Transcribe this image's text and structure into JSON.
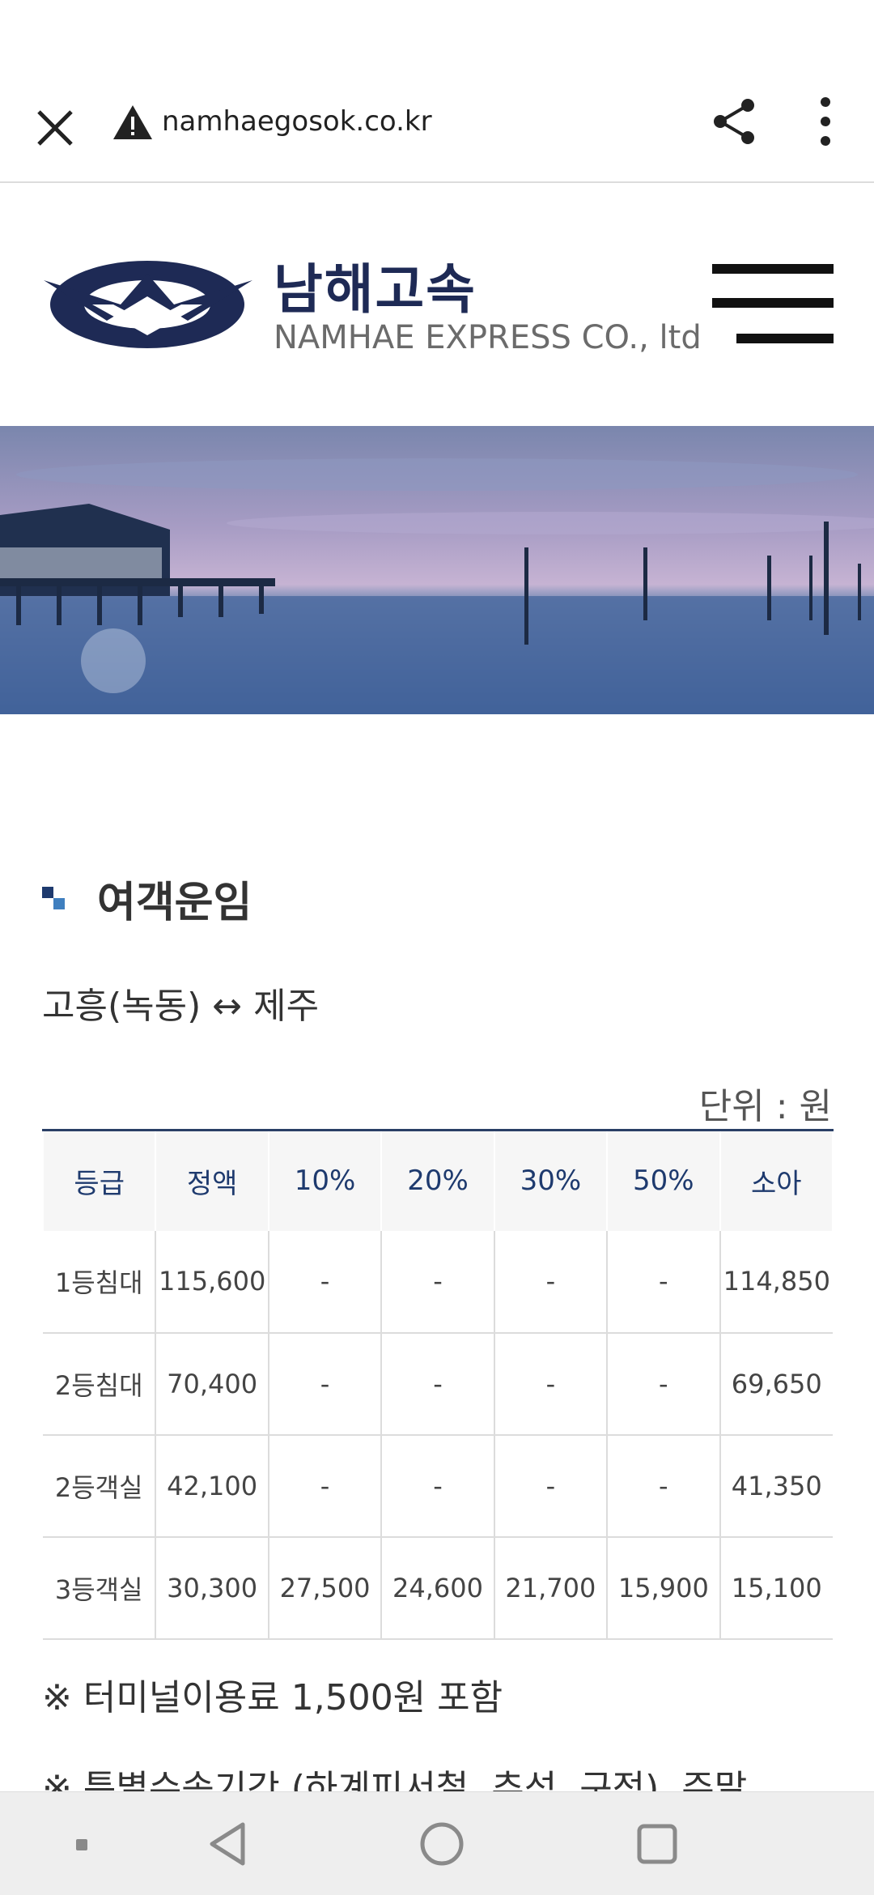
{
  "browser": {
    "domain": "namhaegosok.co.kr",
    "close_icon": "close-icon",
    "warning_icon": "warning-triangle-icon",
    "share_icon": "share-icon",
    "menu_icon": "more-vertical-icon"
  },
  "header": {
    "logo_korean": "남해고속",
    "logo_english": "NAMHAE EXPRESS CO., ltd",
    "brand_color": "#1e2a55"
  },
  "section": {
    "title": "여객운임",
    "route": "고흥(녹동) ↔ 제주",
    "unit": "단위 : 원"
  },
  "fare_table": {
    "headers": [
      "등급",
      "정액",
      "10%",
      "20%",
      "30%",
      "50%",
      "소아"
    ],
    "rows": [
      [
        "1등침대",
        "115,600",
        "-",
        "-",
        "-",
        "-",
        "114,850"
      ],
      [
        "2등침대",
        "70,400",
        "-",
        "-",
        "-",
        "-",
        "69,650"
      ],
      [
        "2등객실",
        "42,100",
        "-",
        "-",
        "-",
        "-",
        "41,350"
      ],
      [
        "3등객실",
        "30,300",
        "27,500",
        "24,600",
        "21,700",
        "15,900",
        "15,100"
      ]
    ]
  },
  "notes": [
    "※ 터미널이용료 1,500원 포함",
    "※ 특별수송기간 (하계피서철, 추석, 구정), 주말"
  ],
  "system_nav": {
    "dot_icon": "nav-dot-icon",
    "back_icon": "back-triangle-icon",
    "home_icon": "home-circle-icon",
    "recents_icon": "recents-square-icon"
  }
}
